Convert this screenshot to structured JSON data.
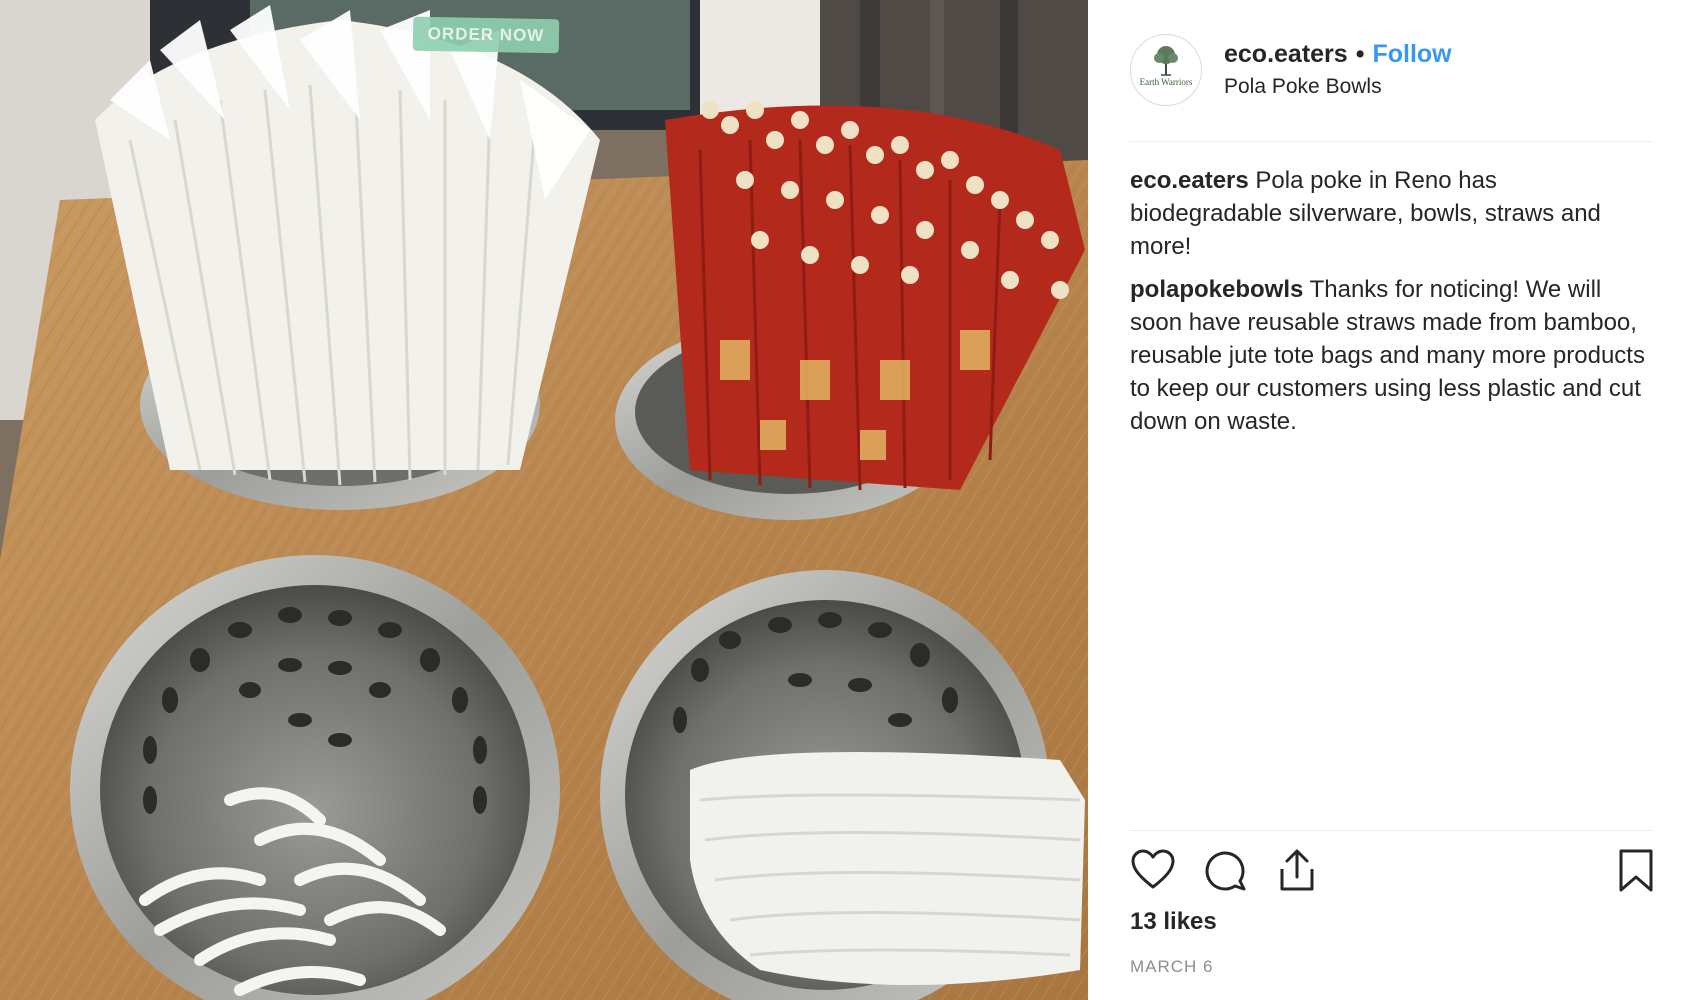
{
  "photo": {
    "sign_text": "ORDER NOW"
  },
  "header": {
    "avatar_text": "Earth Warriors",
    "username": "eco.eaters",
    "separator": "•",
    "follow_label": "Follow",
    "location": "Pola Poke Bowls"
  },
  "comments": [
    {
      "user": "eco.eaters",
      "text": "Pola poke in Reno has biodegradable silverware, bowls, straws and more!"
    },
    {
      "user": "polapokebowls",
      "text": "Thanks for noticing! We will soon have reusable straws made from bamboo, reusable jute tote bags and many more products to keep our customers using less plastic and cut down on waste."
    }
  ],
  "actions": {
    "icons": [
      "heart-icon",
      "comment-icon",
      "share-icon",
      "bookmark-icon"
    ]
  },
  "likes": "13 likes",
  "date": "MARCH 6",
  "colors": {
    "link_blue": "#3897f0",
    "text": "#262626",
    "muted": "#8e8e8e",
    "divider": "#efefef"
  }
}
